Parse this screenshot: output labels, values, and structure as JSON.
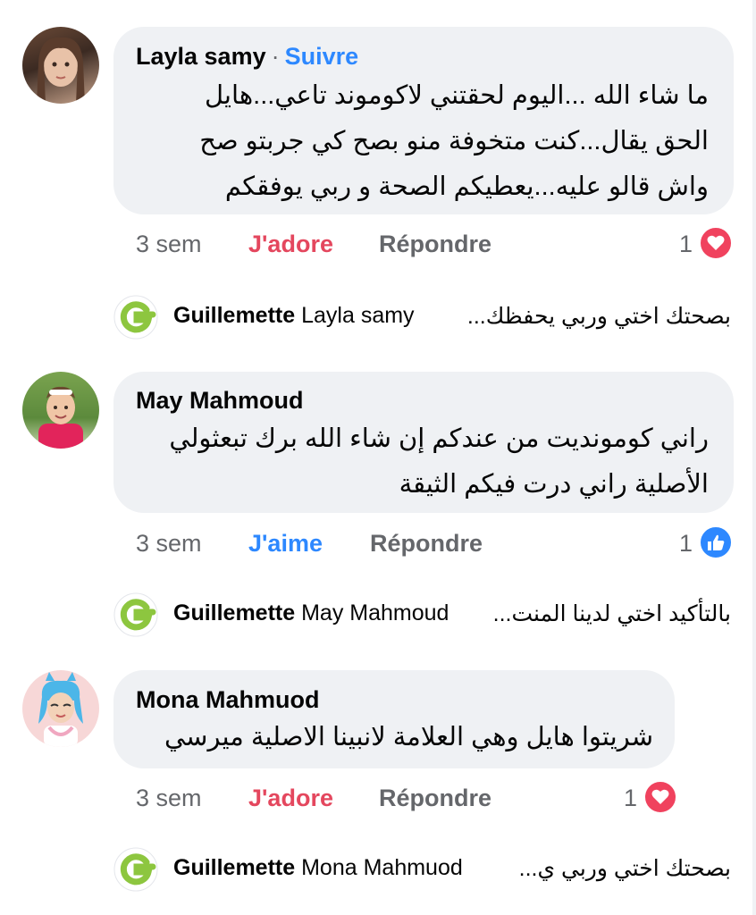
{
  "comments": [
    {
      "author": "Layla samy",
      "follow": "Suivre",
      "lines": [
        "ما شاء الله ...اليوم لحقتني لاكوموند تاعي...هايل",
        "الحق يقال...كنت متخوفة منو بصح كي جربتو صح",
        "واش قالو عليه...يعطيكم الصحة و ربي يوفقكم"
      ],
      "time": "3 sem",
      "reaction_label": "J'adore",
      "reply": "Répondre",
      "reaction_count": "1",
      "reaction_icon": "heart-icon",
      "reply_preview": {
        "page": "Guillemette",
        "target": "Layla samy",
        "snippet": "بصحتك اختي وربي يحفظك..."
      }
    },
    {
      "author": "May Mahmoud",
      "lines": [
        "راني كومونديت من عندكم إن شاء الله برك تبعثولي",
        "الأصلية راني درت فيكم الثيقة"
      ],
      "time": "3 sem",
      "reaction_label": "J'aime",
      "reply": "Répondre",
      "reaction_count": "1",
      "reaction_icon": "thumbs-up-icon",
      "reply_preview": {
        "page": "Guillemette",
        "target": "May Mahmoud",
        "snippet": "بالتأكيد اختي لدينا المنت..."
      }
    },
    {
      "author": "Mona Mahmuod",
      "lines": [
        "شريتوا هايل وهي العلامة لانبينا الاصلية ميرسي"
      ],
      "time": "3 sem",
      "reaction_label": "J'adore",
      "reply": "Répondre",
      "reaction_count": "1",
      "reaction_icon": "heart-icon",
      "reply_preview": {
        "page": "Guillemette",
        "target": "Mona Mahmuod",
        "snippet": "بصحتك اختي وربي ي..."
      }
    }
  ],
  "colors": {
    "bubble": "#eff1f4",
    "love": "#e4475e",
    "like": "#2d88ff",
    "muted": "#65676b",
    "brand_green": "#8dc63f"
  }
}
